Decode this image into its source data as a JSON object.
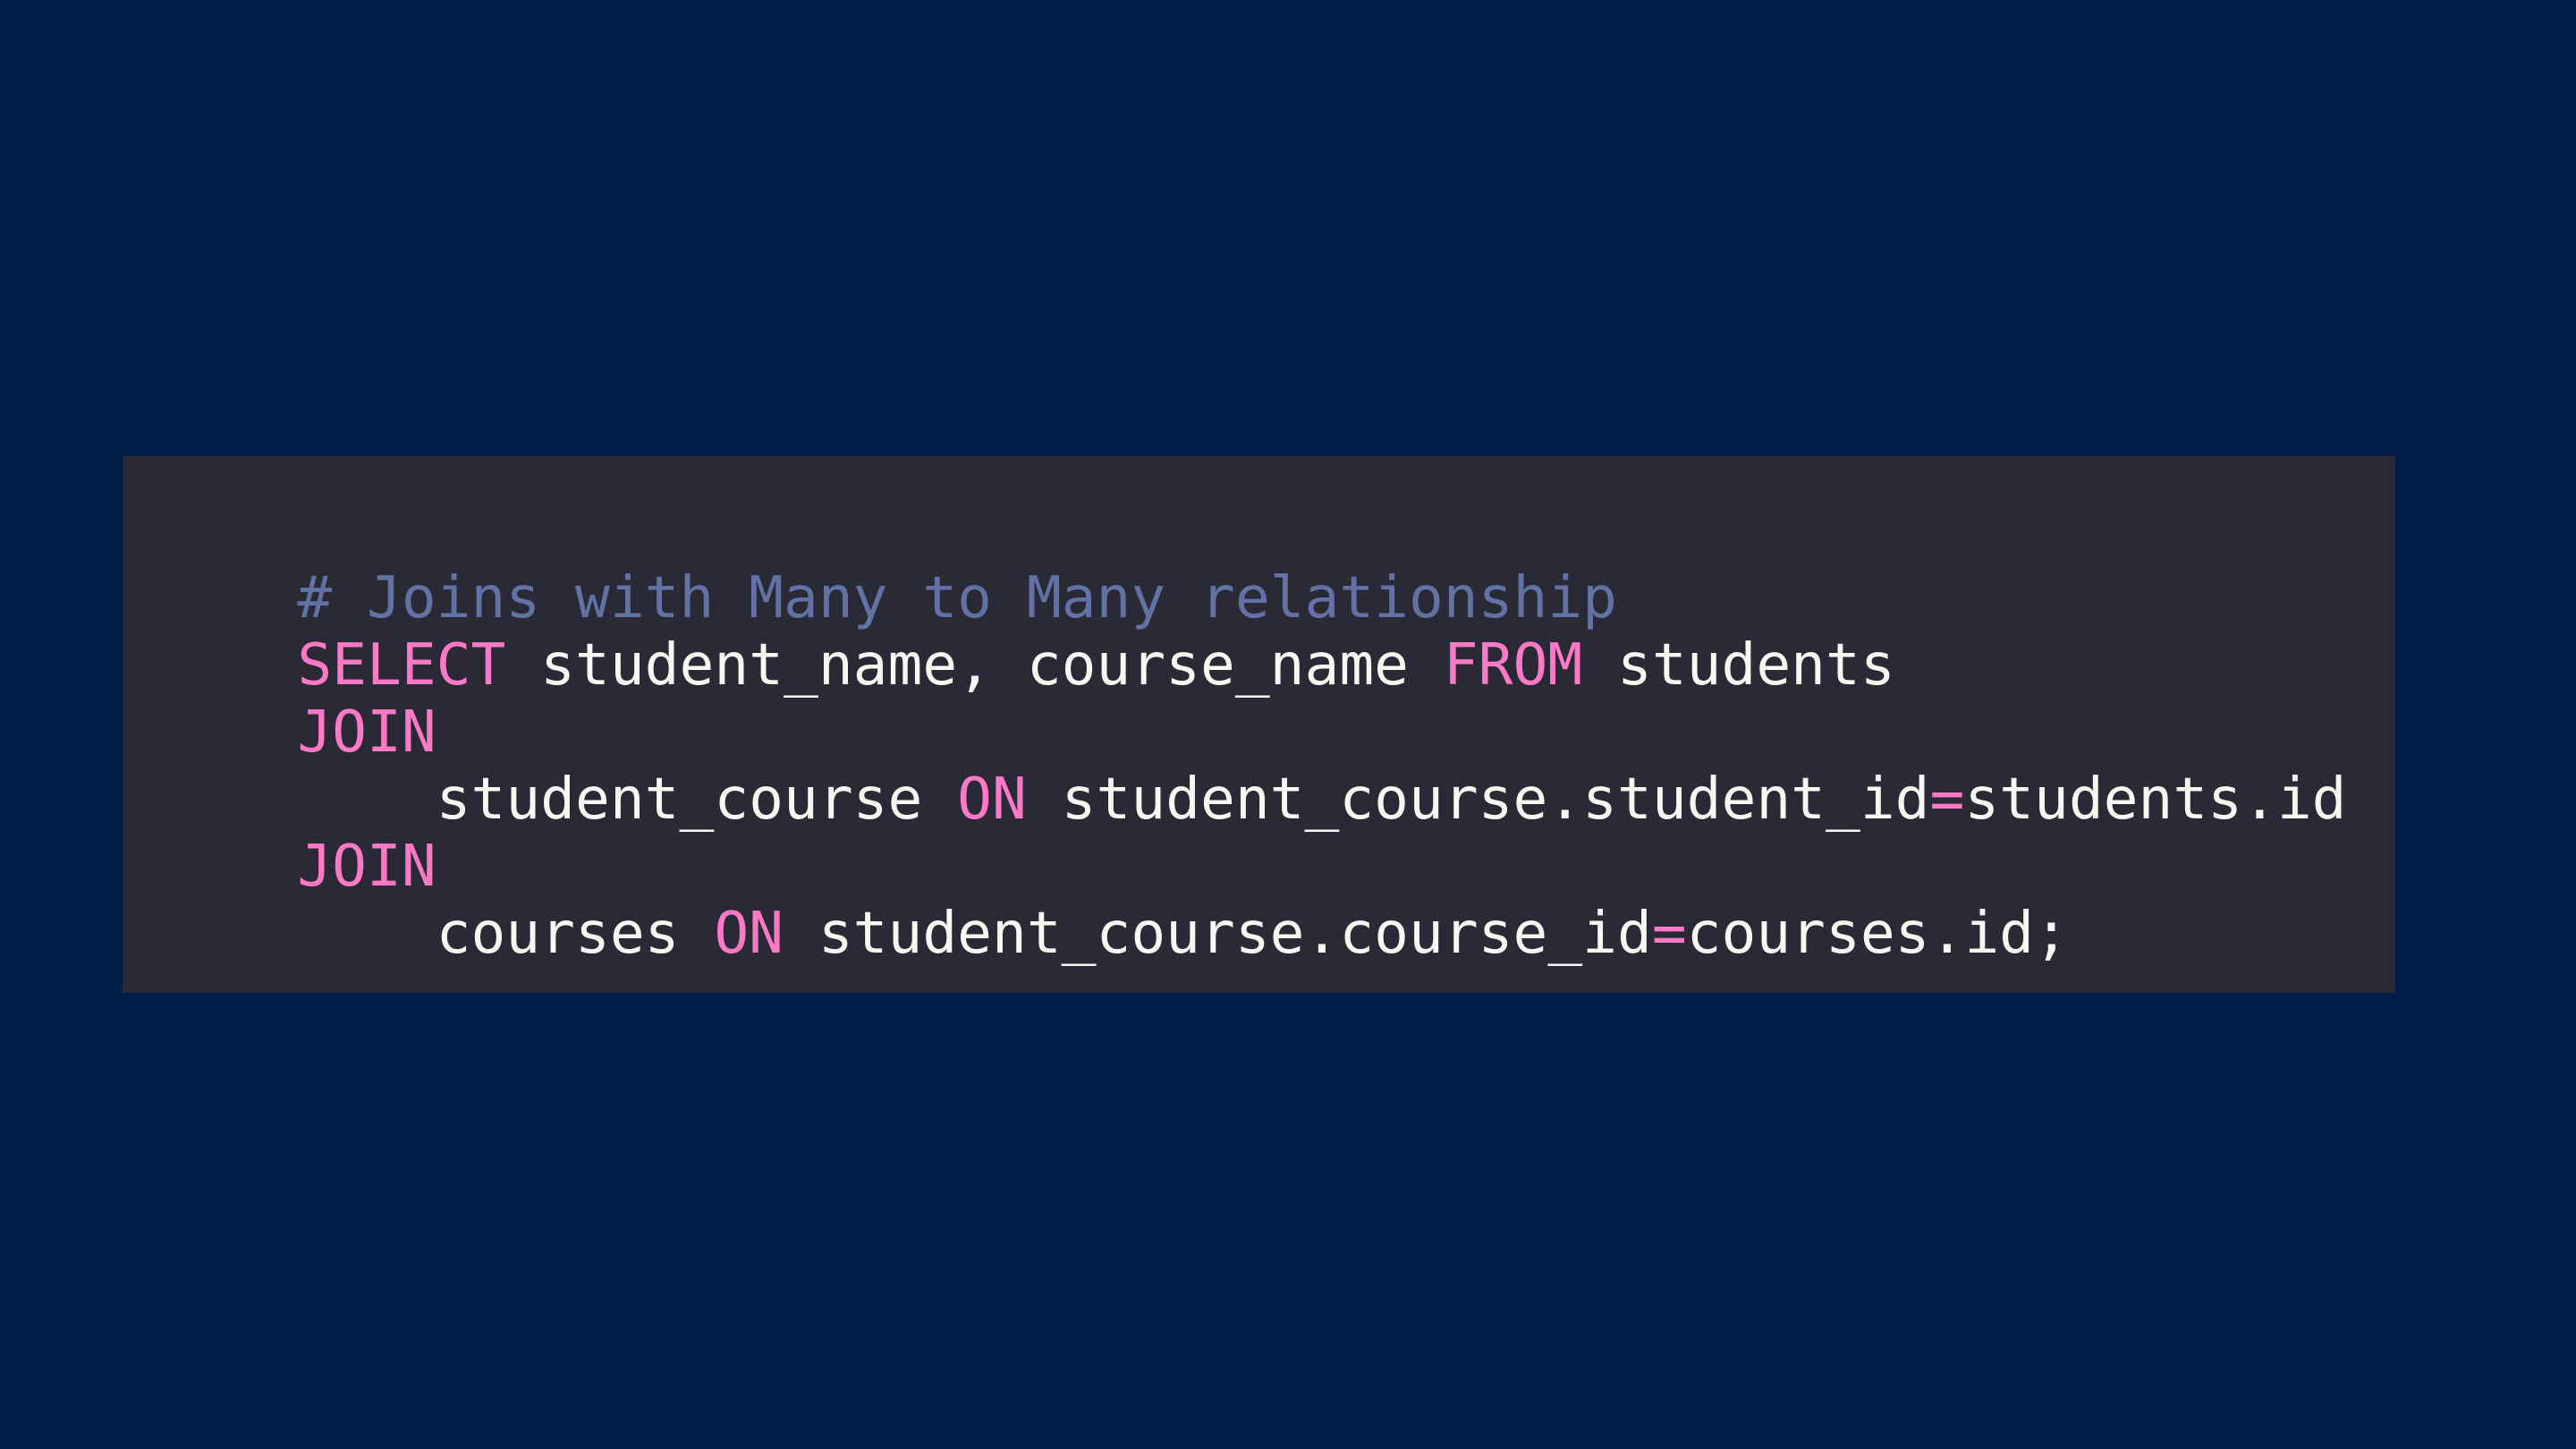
{
  "colors": {
    "background": "#001e4a",
    "panel": "#292a35",
    "comment": "#6272a4",
    "keyword": "#ff79c6",
    "text": "#f8f8f2"
  },
  "code": {
    "language": "sql",
    "lines": [
      [
        {
          "type": "comment",
          "text": "# Joins with Many to Many relationship"
        }
      ],
      [
        {
          "type": "keyword",
          "text": "SELECT"
        },
        {
          "type": "text",
          "text": " student_name, course_name "
        },
        {
          "type": "keyword",
          "text": "FROM"
        },
        {
          "type": "text",
          "text": " students"
        }
      ],
      [
        {
          "type": "keyword",
          "text": "JOIN"
        }
      ],
      [
        {
          "type": "text",
          "text": "    student_course "
        },
        {
          "type": "keyword",
          "text": "ON"
        },
        {
          "type": "text",
          "text": " student_course.student_id"
        },
        {
          "type": "operator",
          "text": "="
        },
        {
          "type": "text",
          "text": "students.id"
        }
      ],
      [
        {
          "type": "keyword",
          "text": "JOIN"
        }
      ],
      [
        {
          "type": "text",
          "text": "    courses "
        },
        {
          "type": "keyword",
          "text": "ON"
        },
        {
          "type": "text",
          "text": " student_course.course_id"
        },
        {
          "type": "operator",
          "text": "="
        },
        {
          "type": "text",
          "text": "courses.id;"
        }
      ]
    ]
  }
}
